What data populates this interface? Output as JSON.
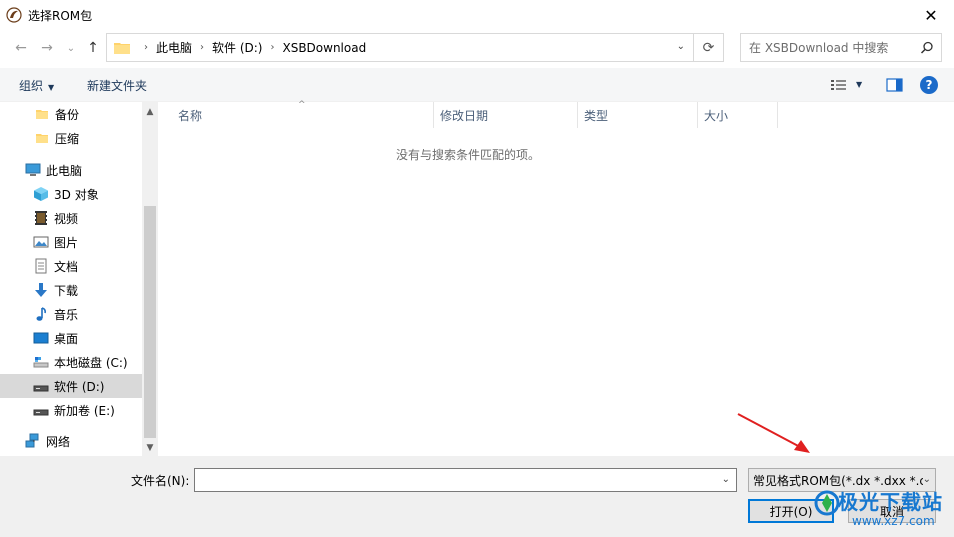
{
  "window": {
    "title": "选择ROM包",
    "close_glyph": "✕"
  },
  "nav": {
    "back_glyph": "←",
    "forward_glyph": "→",
    "recent_glyph": "⌄",
    "up_glyph": "↑",
    "breadcrumbs": [
      "此电脑",
      "软件 (D:)",
      "XSBDownload"
    ],
    "refresh_glyph": "⟳",
    "search_placeholder": "在 XSBDownload 中搜索"
  },
  "toolbar": {
    "organize_label": "组织",
    "new_folder_label": "新建文件夹",
    "help_label": "?"
  },
  "sidebar": {
    "items": [
      {
        "label": "备份",
        "icon": "folder-icon"
      },
      {
        "label": "压缩",
        "icon": "folder-icon"
      },
      {
        "label": "此电脑",
        "icon": "computer-icon"
      },
      {
        "label": "3D 对象",
        "icon": "3d-objects-icon"
      },
      {
        "label": "视频",
        "icon": "video-icon"
      },
      {
        "label": "图片",
        "icon": "pictures-icon"
      },
      {
        "label": "文档",
        "icon": "documents-icon"
      },
      {
        "label": "下载",
        "icon": "download-icon"
      },
      {
        "label": "音乐",
        "icon": "music-icon"
      },
      {
        "label": "桌面",
        "icon": "desktop-icon"
      },
      {
        "label": "本地磁盘 (C:)",
        "icon": "drive-icon"
      },
      {
        "label": "软件 (D:)",
        "icon": "drive-icon"
      },
      {
        "label": "新加卷 (E:)",
        "icon": "drive-icon"
      },
      {
        "label": "网络",
        "icon": "network-icon"
      }
    ],
    "selected_index": 11
  },
  "columns": [
    "名称",
    "修改日期",
    "类型",
    "大小"
  ],
  "empty_message": "没有与搜索条件匹配的项。",
  "footer": {
    "filename_label": "文件名(N):",
    "filename_value": "",
    "filter_value": "常见格式ROM包(*.dx *.dxx *.c",
    "open_label": "打开(O)",
    "cancel_label": "取消"
  },
  "watermark": {
    "text": "极光下载站",
    "url": "www.xz7.com"
  },
  "colors": {
    "accent": "#0078d7",
    "selected_bg": "#d9d9d9",
    "annotation_arrow": "#e02020"
  }
}
